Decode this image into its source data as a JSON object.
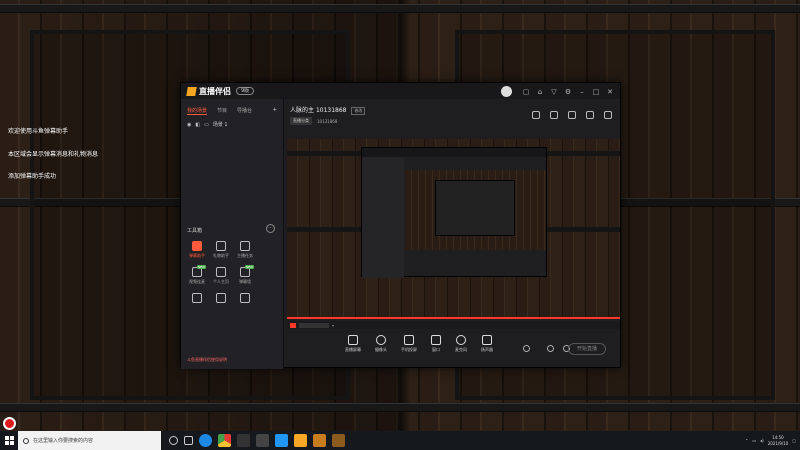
{
  "desktop": {
    "notifications": [
      "欢迎使用斗鱼弹幕助手",
      "本区域会显示弹幕消息和礼物消息",
      "添加弹幕助手成功"
    ]
  },
  "app": {
    "logo_text": "直播伴侣",
    "version_pill": "9版",
    "titlebar_icons": [
      "avatar",
      "message-icon",
      "shirt-icon",
      "gift-icon",
      "settings-icon",
      "minimize-icon",
      "maximize-icon",
      "close-icon"
    ],
    "sidebar": {
      "tabs": [
        "我的场景",
        "节目",
        "导播台"
      ],
      "add": "+",
      "scene": "场景 1",
      "tools_title": "工具箱",
      "tools_more": "···",
      "tools": [
        {
          "label": "弹幕助手",
          "active": true
        },
        {
          "label": "礼物助手",
          "active": false
        },
        {
          "label": "主播任务",
          "active": false
        },
        {
          "label": "",
          "active": false
        },
        {
          "label": "视频连麦",
          "active": false,
          "badge": "NEW"
        },
        {
          "label": "个人主页",
          "active": false
        },
        {
          "label": "弹幕墙",
          "active": false,
          "badge": "NEW"
        },
        {
          "label": "",
          "active": false
        },
        {
          "label": "",
          "active": false
        },
        {
          "label": "",
          "active": false
        },
        {
          "label": "",
          "active": false
        },
        {
          "label": "",
          "active": false
        }
      ],
      "footer": "斗鱼直播伴侣使用说明"
    },
    "room": {
      "title": "人脉的主",
      "room_id": "10131868",
      "tag": "修改",
      "category_chip": "直播分类",
      "sub_info": "10131868"
    },
    "controls": [
      {
        "label": "直播屏幕"
      },
      {
        "label": "摄像头"
      },
      {
        "label": "手机投屏"
      },
      {
        "label": "窗口"
      },
      {
        "label": "麦克风"
      },
      {
        "label": "扬声器"
      }
    ],
    "start_button": "开始直播"
  },
  "taskbar": {
    "search_placeholder": "在这里输入你要搜索的内容",
    "time": "14:50",
    "date": "2021/9/10"
  },
  "colors": {
    "accent": "#ff5a3c",
    "window_bg": "#1e1e20",
    "record": "#e01b1b"
  }
}
